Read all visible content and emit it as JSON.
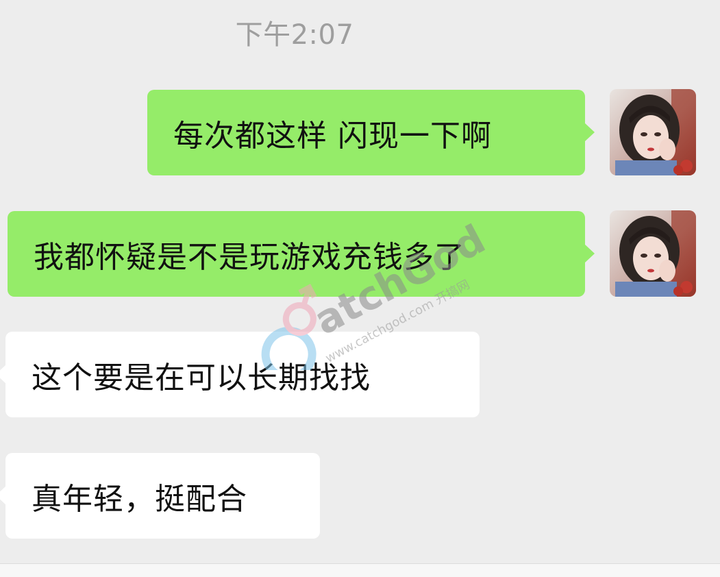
{
  "chat": {
    "timestamp": "下午2:07",
    "messages": [
      {
        "direction": "out",
        "text": "每次都这样 闪现一下啊"
      },
      {
        "direction": "out",
        "text": "我都怀疑是不是玩游戏充钱多了"
      },
      {
        "direction": "in",
        "text": "这个要是在可以长期找找"
      },
      {
        "direction": "in",
        "text": "真年轻，挺配合"
      }
    ]
  },
  "watermark": {
    "logo": "CatchGod",
    "url": "www.catchgod.com 开搞网"
  },
  "colors": {
    "background": "#ededed",
    "outgoing_bubble": "#95ec69",
    "incoming_bubble": "#ffffff",
    "timestamp": "#9e9e9e"
  }
}
